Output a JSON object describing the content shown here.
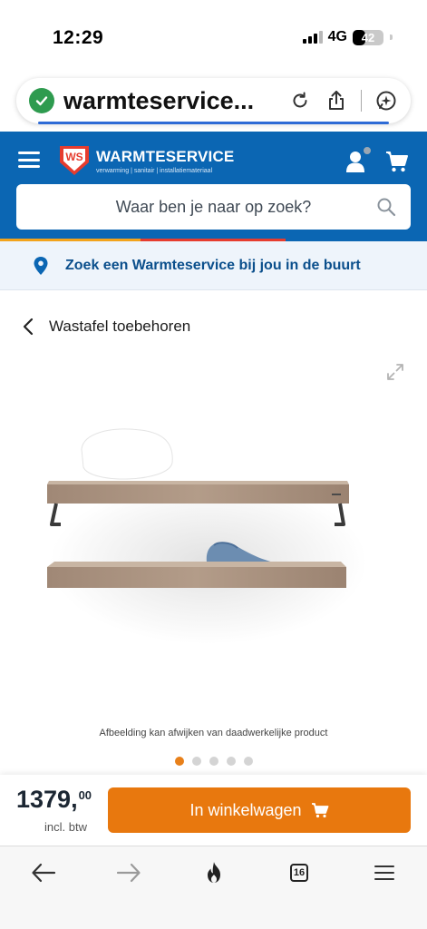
{
  "status_bar": {
    "time": "12:29",
    "network": "4G",
    "battery": "42",
    "battery_level": 0.42,
    "signal_bars": 4,
    "signal_active": 3
  },
  "browser": {
    "url": "warmteservice...",
    "security_icon": "shield-check-icon",
    "reload_icon": "reload-icon",
    "share_icon": "share-icon",
    "assistant_icon": "sparkle-chat-icon",
    "tabs_count": "16"
  },
  "site": {
    "brand": "WARMTESERVICE",
    "tagline": "verwarming | sanitair | installatiemateriaal",
    "logo_letters": "WS",
    "search_placeholder": "Waar ben je naar op zoek?",
    "store_finder": "Zoek een Warmteservice bij jou in de buurt"
  },
  "product": {
    "breadcrumb": "Wastafel toebehoren",
    "image_note": "Afbeelding kan afwijken van daadwerkelijke product",
    "image_count": 5,
    "active_image": 0,
    "price_main": "1379,",
    "price_cents": "00",
    "price_vat": "incl. btw",
    "cart_label": "In winkelwagen"
  },
  "colors": {
    "brand_blue": "#0b66b3",
    "accent_orange": "#e8780e",
    "logo_red": "#e63c2e",
    "logo_yellow": "#f2a31b",
    "secure_green": "#2e9b4f"
  }
}
